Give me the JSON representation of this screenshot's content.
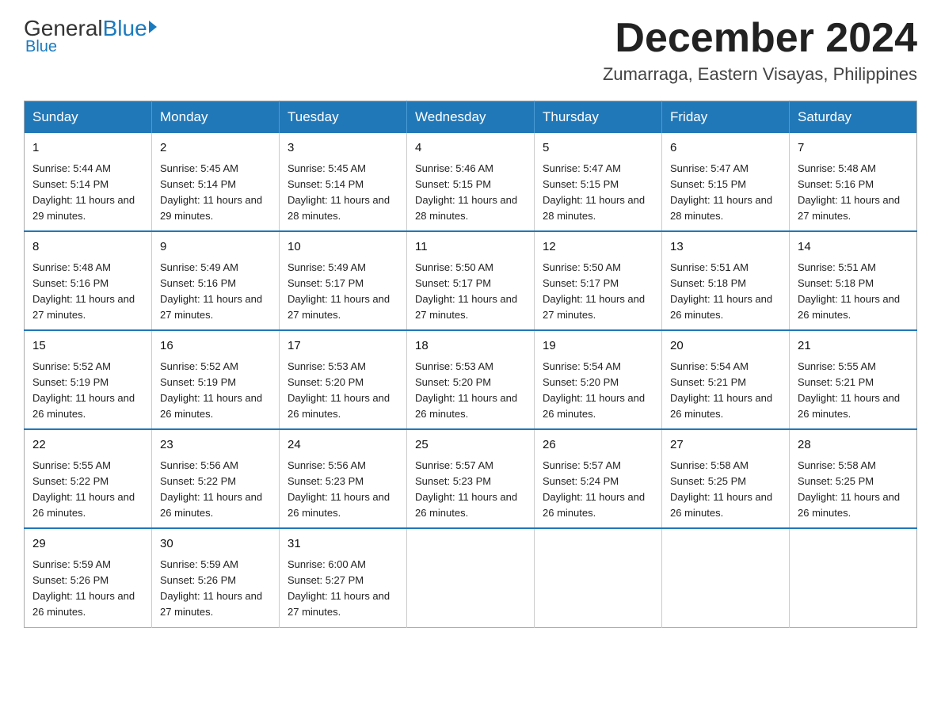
{
  "header": {
    "logo_general": "General",
    "logo_blue": "Blue",
    "month_title": "December 2024",
    "location": "Zumarraga, Eastern Visayas, Philippines"
  },
  "weekdays": [
    "Sunday",
    "Monday",
    "Tuesday",
    "Wednesday",
    "Thursday",
    "Friday",
    "Saturday"
  ],
  "weeks": [
    [
      {
        "day": "1",
        "sunrise": "5:44 AM",
        "sunset": "5:14 PM",
        "daylight": "11 hours and 29 minutes."
      },
      {
        "day": "2",
        "sunrise": "5:45 AM",
        "sunset": "5:14 PM",
        "daylight": "11 hours and 29 minutes."
      },
      {
        "day": "3",
        "sunrise": "5:45 AM",
        "sunset": "5:14 PM",
        "daylight": "11 hours and 28 minutes."
      },
      {
        "day": "4",
        "sunrise": "5:46 AM",
        "sunset": "5:15 PM",
        "daylight": "11 hours and 28 minutes."
      },
      {
        "day": "5",
        "sunrise": "5:47 AM",
        "sunset": "5:15 PM",
        "daylight": "11 hours and 28 minutes."
      },
      {
        "day": "6",
        "sunrise": "5:47 AM",
        "sunset": "5:15 PM",
        "daylight": "11 hours and 28 minutes."
      },
      {
        "day": "7",
        "sunrise": "5:48 AM",
        "sunset": "5:16 PM",
        "daylight": "11 hours and 27 minutes."
      }
    ],
    [
      {
        "day": "8",
        "sunrise": "5:48 AM",
        "sunset": "5:16 PM",
        "daylight": "11 hours and 27 minutes."
      },
      {
        "day": "9",
        "sunrise": "5:49 AM",
        "sunset": "5:16 PM",
        "daylight": "11 hours and 27 minutes."
      },
      {
        "day": "10",
        "sunrise": "5:49 AM",
        "sunset": "5:17 PM",
        "daylight": "11 hours and 27 minutes."
      },
      {
        "day": "11",
        "sunrise": "5:50 AM",
        "sunset": "5:17 PM",
        "daylight": "11 hours and 27 minutes."
      },
      {
        "day": "12",
        "sunrise": "5:50 AM",
        "sunset": "5:17 PM",
        "daylight": "11 hours and 27 minutes."
      },
      {
        "day": "13",
        "sunrise": "5:51 AM",
        "sunset": "5:18 PM",
        "daylight": "11 hours and 26 minutes."
      },
      {
        "day": "14",
        "sunrise": "5:51 AM",
        "sunset": "5:18 PM",
        "daylight": "11 hours and 26 minutes."
      }
    ],
    [
      {
        "day": "15",
        "sunrise": "5:52 AM",
        "sunset": "5:19 PM",
        "daylight": "11 hours and 26 minutes."
      },
      {
        "day": "16",
        "sunrise": "5:52 AM",
        "sunset": "5:19 PM",
        "daylight": "11 hours and 26 minutes."
      },
      {
        "day": "17",
        "sunrise": "5:53 AM",
        "sunset": "5:20 PM",
        "daylight": "11 hours and 26 minutes."
      },
      {
        "day": "18",
        "sunrise": "5:53 AM",
        "sunset": "5:20 PM",
        "daylight": "11 hours and 26 minutes."
      },
      {
        "day": "19",
        "sunrise": "5:54 AM",
        "sunset": "5:20 PM",
        "daylight": "11 hours and 26 minutes."
      },
      {
        "day": "20",
        "sunrise": "5:54 AM",
        "sunset": "5:21 PM",
        "daylight": "11 hours and 26 minutes."
      },
      {
        "day": "21",
        "sunrise": "5:55 AM",
        "sunset": "5:21 PM",
        "daylight": "11 hours and 26 minutes."
      }
    ],
    [
      {
        "day": "22",
        "sunrise": "5:55 AM",
        "sunset": "5:22 PM",
        "daylight": "11 hours and 26 minutes."
      },
      {
        "day": "23",
        "sunrise": "5:56 AM",
        "sunset": "5:22 PM",
        "daylight": "11 hours and 26 minutes."
      },
      {
        "day": "24",
        "sunrise": "5:56 AM",
        "sunset": "5:23 PM",
        "daylight": "11 hours and 26 minutes."
      },
      {
        "day": "25",
        "sunrise": "5:57 AM",
        "sunset": "5:23 PM",
        "daylight": "11 hours and 26 minutes."
      },
      {
        "day": "26",
        "sunrise": "5:57 AM",
        "sunset": "5:24 PM",
        "daylight": "11 hours and 26 minutes."
      },
      {
        "day": "27",
        "sunrise": "5:58 AM",
        "sunset": "5:25 PM",
        "daylight": "11 hours and 26 minutes."
      },
      {
        "day": "28",
        "sunrise": "5:58 AM",
        "sunset": "5:25 PM",
        "daylight": "11 hours and 26 minutes."
      }
    ],
    [
      {
        "day": "29",
        "sunrise": "5:59 AM",
        "sunset": "5:26 PM",
        "daylight": "11 hours and 26 minutes."
      },
      {
        "day": "30",
        "sunrise": "5:59 AM",
        "sunset": "5:26 PM",
        "daylight": "11 hours and 27 minutes."
      },
      {
        "day": "31",
        "sunrise": "6:00 AM",
        "sunset": "5:27 PM",
        "daylight": "11 hours and 27 minutes."
      },
      null,
      null,
      null,
      null
    ]
  ]
}
